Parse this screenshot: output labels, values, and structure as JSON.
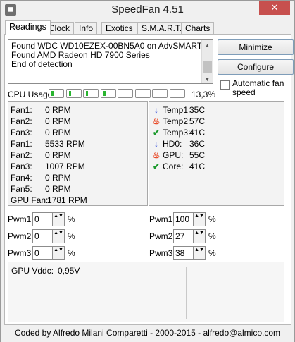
{
  "window": {
    "title": "SpeedFan 4.51",
    "close_glyph": "✕"
  },
  "tabs": [
    "Readings",
    "Clock",
    "Info",
    "Exotics",
    "S.M.A.R.T.",
    "Charts"
  ],
  "log_lines": [
    "Found WDC WD10EZEX-00BN5A0 on AdvSMART",
    "Found AMD Radeon HD 7900 Series",
    "End of detection"
  ],
  "buttons": {
    "minimize": "Minimize",
    "configure": "Configure"
  },
  "auto_fan": {
    "label": "Automatic fan speed",
    "checked": false
  },
  "cpu": {
    "label": "CPU Usage",
    "percent_text": "13,3%",
    "core_count": 8,
    "active_cores": [
      0,
      1,
      2,
      3
    ]
  },
  "fans": [
    {
      "label": "Fan1:",
      "value": "0 RPM"
    },
    {
      "label": "Fan2:",
      "value": "0 RPM"
    },
    {
      "label": "Fan3:",
      "value": "0 RPM"
    },
    {
      "label": "Fan1:",
      "value": "5533 RPM"
    },
    {
      "label": "Fan2:",
      "value": "0 RPM"
    },
    {
      "label": "Fan3:",
      "value": "1007 RPM"
    },
    {
      "label": "Fan4:",
      "value": "0 RPM"
    },
    {
      "label": "Fan5:",
      "value": "0 RPM"
    },
    {
      "label": "GPU Fan:",
      "value": "1781 RPM"
    }
  ],
  "temps": [
    {
      "label": "Temp1:",
      "value": "35C",
      "icon": "arrow-down-icon"
    },
    {
      "label": "Temp2:",
      "value": "57C",
      "icon": "flame-icon"
    },
    {
      "label": "Temp3:",
      "value": "41C",
      "icon": "checkmark-icon"
    },
    {
      "label": "HD0:",
      "value": "36C",
      "icon": "arrow-down-icon"
    },
    {
      "label": "GPU:",
      "value": "55C",
      "icon": "flame-icon"
    },
    {
      "label": "Core:",
      "value": "41C",
      "icon": "checkmark-icon"
    }
  ],
  "pwm_left": [
    {
      "label": "Pwm1:",
      "value": "0",
      "unit": "%"
    },
    {
      "label": "Pwm2:",
      "value": "0",
      "unit": "%"
    },
    {
      "label": "Pwm3:",
      "value": "0",
      "unit": "%"
    }
  ],
  "pwm_right": [
    {
      "label": "Pwm1:",
      "value": "100",
      "unit": "%"
    },
    {
      "label": "Pwm2:",
      "value": "27",
      "unit": "%"
    },
    {
      "label": "Pwm3:",
      "value": "38",
      "unit": "%"
    }
  ],
  "voltage": {
    "label": "GPU Vddc:",
    "value": "0,95V"
  },
  "status_bar": "Coded by Alfredo Milani Comparetti - 2000-2015 - alfredo@almico.com",
  "colors": {
    "cpu_fill": "#29b52f",
    "cold": "#1f3fd6",
    "hot": "#e8401c",
    "ok": "#1d9a2e",
    "close": "#c7504e"
  }
}
